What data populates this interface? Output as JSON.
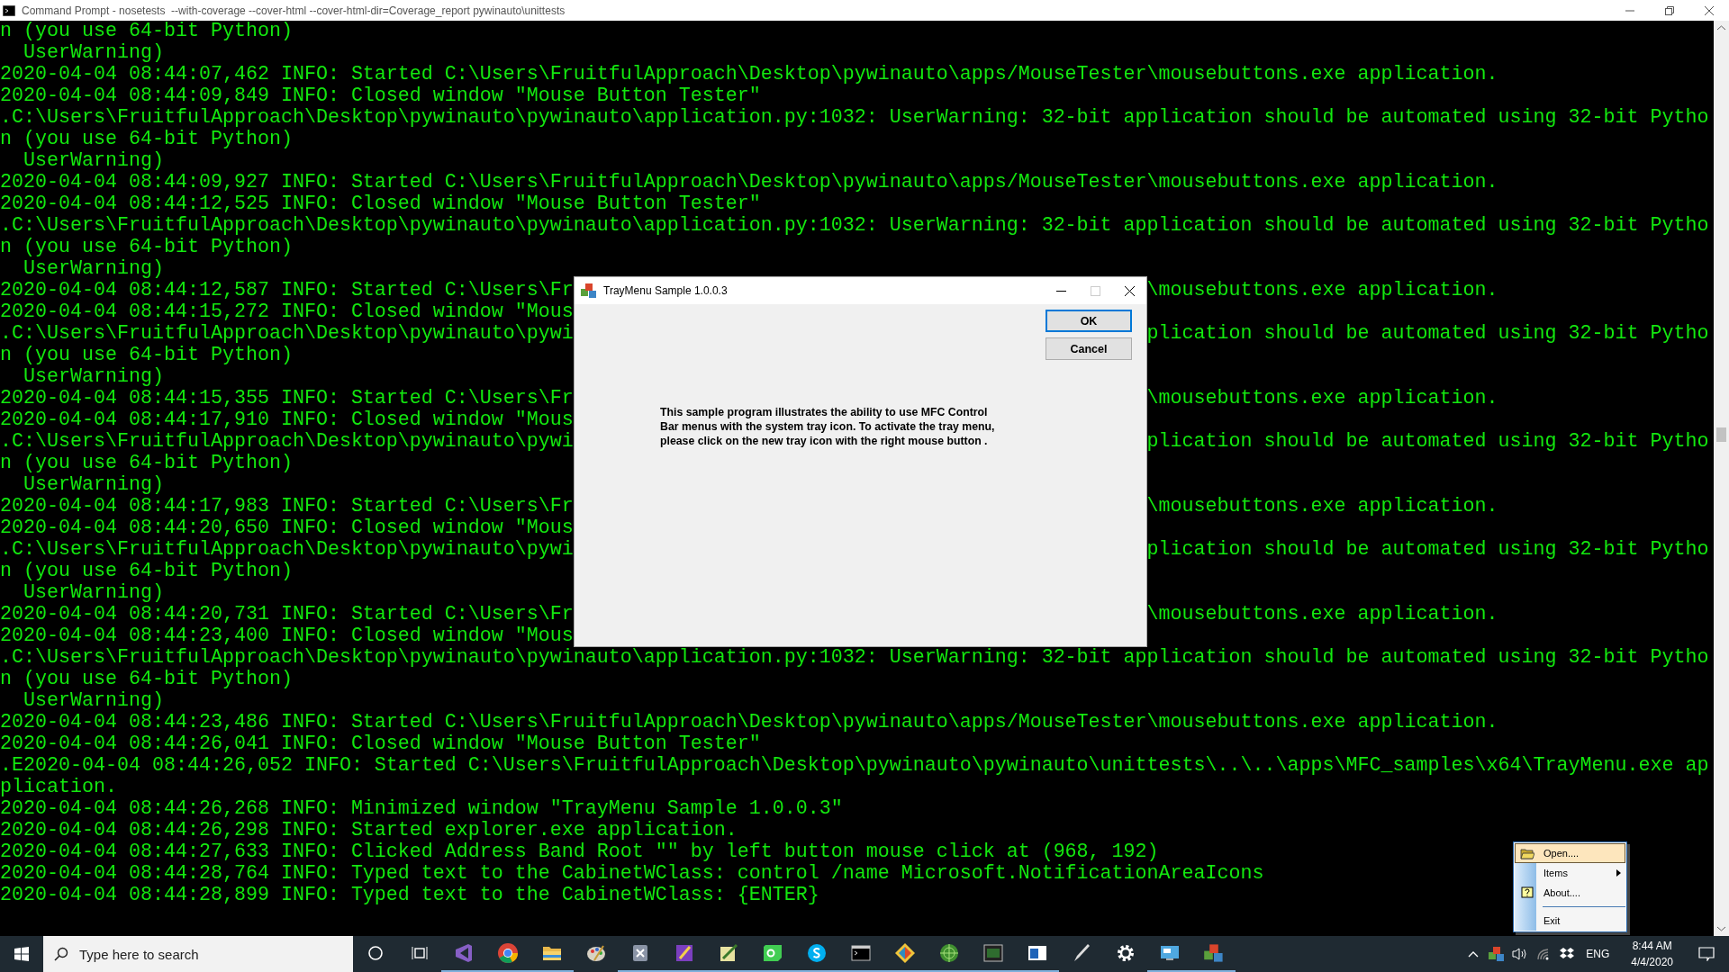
{
  "window": {
    "title": "Command Prompt - nosetests  --with-coverage --cover-html --cover-html-dir=Coverage_report pywinauto\\unittests"
  },
  "console": {
    "rows": [
      {
        "text": "n (you use 64-bit Python)"
      },
      {
        "text": "  UserWarning)"
      },
      {
        "text": "2020-04-04 08:44:07,462 INFO: Started C:\\Users\\FruitfulApproach\\Desktop\\pywinauto\\apps/MouseTester\\mousebuttons.exe application."
      },
      {
        "text": "2020-04-04 08:44:09,849 INFO: Closed window \"Mouse Button Tester\""
      },
      {
        "text": ".C:\\Users\\FruitfulApproach\\Desktop\\pywinauto\\pywinauto\\application.py:1032: UserWarning: 32-bit application should be automated using 32-bit Pytho"
      },
      {
        "text": "n (you use 64-bit Python)"
      },
      {
        "text": "  UserWarning)"
      },
      {
        "text": "2020-04-04 08:44:09,927 INFO: Started C:\\Users\\FruitfulApproach\\Desktop\\pywinauto\\apps/MouseTester\\mousebuttons.exe application."
      },
      {
        "text": "2020-04-04 08:44:12,525 INFO: Closed window \"Mouse Button Tester\""
      },
      {
        "text": ".C:\\Users\\FruitfulApproach\\Desktop\\pywinauto\\pywinauto\\application.py:1032: UserWarning: 32-bit application should be automated using 32-bit Pytho"
      },
      {
        "text": "n (you use 64-bit Python)"
      },
      {
        "text": "  UserWarning)"
      },
      {
        "left": "2020-04-04 08:44:12,587 INFO: Started C:\\Users\\Fr",
        "right": "\\mousebuttons.exe application."
      },
      {
        "left": "2020-04-04 08:44:15,272 INFO: Closed window \"Mous"
      },
      {
        "left": ".C:\\Users\\FruitfulApproach\\Desktop\\pywinauto\\pywi",
        "right": "plication should be automated using 32-bit Pytho"
      },
      {
        "text": "n (you use 64-bit Python)"
      },
      {
        "text": "  UserWarning)"
      },
      {
        "left": "2020-04-04 08:44:15,355 INFO: Started C:\\Users\\Fr",
        "right": "\\mousebuttons.exe application."
      },
      {
        "left": "2020-04-04 08:44:17,910 INFO: Closed window \"Mous"
      },
      {
        "left": ".C:\\Users\\FruitfulApproach\\Desktop\\pywinauto\\pywi",
        "right": "plication should be automated using 32-bit Pytho"
      },
      {
        "text": "n (you use 64-bit Python)"
      },
      {
        "text": "  UserWarning)"
      },
      {
        "left": "2020-04-04 08:44:17,983 INFO: Started C:\\Users\\Fr",
        "right": "\\mousebuttons.exe application."
      },
      {
        "left": "2020-04-04 08:44:20,650 INFO: Closed window \"Mous"
      },
      {
        "left": ".C:\\Users\\FruitfulApproach\\Desktop\\pywinauto\\pywi",
        "right": "plication should be automated using 32-bit Pytho"
      },
      {
        "text": "n (you use 64-bit Python)"
      },
      {
        "text": "  UserWarning)"
      },
      {
        "left": "2020-04-04 08:44:20,731 INFO: Started C:\\Users\\Fr",
        "right": "\\mousebuttons.exe application."
      },
      {
        "left": "2020-04-04 08:44:23,400 INFO: Closed window \"Mous"
      },
      {
        "text": ".C:\\Users\\FruitfulApproach\\Desktop\\pywinauto\\pywinauto\\application.py:1032: UserWarning: 32-bit application should be automated using 32-bit Pytho"
      },
      {
        "text": "n (you use 64-bit Python)"
      },
      {
        "text": "  UserWarning)"
      },
      {
        "text": "2020-04-04 08:44:23,486 INFO: Started C:\\Users\\FruitfulApproach\\Desktop\\pywinauto\\apps/MouseTester\\mousebuttons.exe application."
      },
      {
        "text": "2020-04-04 08:44:26,041 INFO: Closed window \"Mouse Button Tester\""
      },
      {
        "text": ".E2020-04-04 08:44:26,052 INFO: Started C:\\Users\\FruitfulApproach\\Desktop\\pywinauto\\pywinauto\\unittests\\..\\..\\apps\\MFC_samples\\x64\\TrayMenu.exe ap"
      },
      {
        "text": "plication."
      },
      {
        "text": "2020-04-04 08:44:26,268 INFO: Minimized window \"TrayMenu Sample 1.0.0.3\""
      },
      {
        "text": "2020-04-04 08:44:26,298 INFO: Started explorer.exe application."
      },
      {
        "text": "2020-04-04 08:44:27,633 INFO: Clicked Address Band Root \"\" by left button mouse click at (968, 192)"
      },
      {
        "text": "2020-04-04 08:44:28,764 INFO: Typed text to the CabinetWClass: control /name Microsoft.NotificationAreaIcons"
      },
      {
        "text": "2020-04-04 08:44:28,899 INFO: Typed text to the CabinetWClass: {ENTER}"
      }
    ]
  },
  "dialog": {
    "title": "TrayMenu Sample 1.0.0.3",
    "buttons": [
      {
        "label": "OK",
        "default": true
      },
      {
        "label": "Cancel",
        "default": false
      }
    ],
    "message_lines": [
      "This sample program illustrates the ability to use MFC Control",
      "Bar menus with the system tray icon.  To activate the tray menu,",
      "please click on the new tray icon with the right mouse button ."
    ]
  },
  "tray_menu": {
    "items": [
      {
        "kind": "open",
        "label": "Open....",
        "selected": true
      },
      {
        "kind": "submenu",
        "label": "Items",
        "selected": false
      },
      {
        "kind": "about",
        "label": "About....",
        "selected": false
      },
      {
        "kind": "separator"
      },
      {
        "kind": "item",
        "label": "Exit",
        "selected": false
      }
    ]
  },
  "taskbar": {
    "search": {
      "placeholder": "Type here to search"
    },
    "apps": [
      {
        "kind": "vs",
        "running": true
      },
      {
        "kind": "chrome",
        "running": true
      },
      {
        "kind": "folder",
        "running": true
      },
      {
        "kind": "paint",
        "running": false
      },
      {
        "kind": "tool",
        "running": true
      },
      {
        "kind": "purple",
        "running": true
      },
      {
        "kind": "editor",
        "running": true
      },
      {
        "kind": "qt",
        "running": true
      },
      {
        "kind": "skype",
        "running": true
      },
      {
        "kind": "terminal",
        "running": true
      },
      {
        "kind": "git",
        "running": true
      },
      {
        "kind": "globe",
        "running": true
      },
      {
        "kind": "console",
        "running": true
      },
      {
        "kind": "window",
        "running": true
      },
      {
        "kind": "pen",
        "running": false
      },
      {
        "kind": "gear",
        "running": false
      },
      {
        "kind": "screen",
        "running": true
      },
      {
        "kind": "blocks",
        "running": true
      }
    ],
    "language": "ENG",
    "time": "8:44 AM",
    "date": "4/4/2020"
  }
}
